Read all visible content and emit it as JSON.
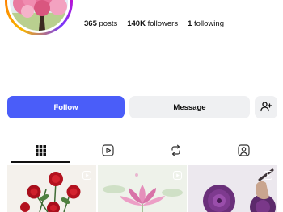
{
  "profile": {
    "avatar_icon": "cherry-blossom-tree-painting"
  },
  "stats": {
    "posts_count": "365",
    "posts_label": "posts",
    "followers_count": "140K",
    "followers_label": "followers",
    "following_count": "1",
    "following_label": "following"
  },
  "actions": {
    "follow_label": "Follow",
    "message_label": "Message",
    "add_user_icon": "add-user-icon"
  },
  "tabs": [
    {
      "name": "posts-grid",
      "icon": "grid-icon",
      "active": true
    },
    {
      "name": "reels",
      "icon": "reels-icon",
      "active": false
    },
    {
      "name": "reposts",
      "icon": "repost-icon",
      "active": false
    },
    {
      "name": "tagged",
      "icon": "tagged-icon",
      "active": false
    }
  ],
  "grid_posts": [
    {
      "subject": "red-roses-painting",
      "type": "reel"
    },
    {
      "subject": "pink-lotus-painting",
      "type": "reel"
    },
    {
      "subject": "purple-dahlia-painting",
      "type": "reel"
    }
  ],
  "colors": {
    "accent": "#4a5df9",
    "secondary_button": "#eff0f2",
    "text": "#111111"
  }
}
